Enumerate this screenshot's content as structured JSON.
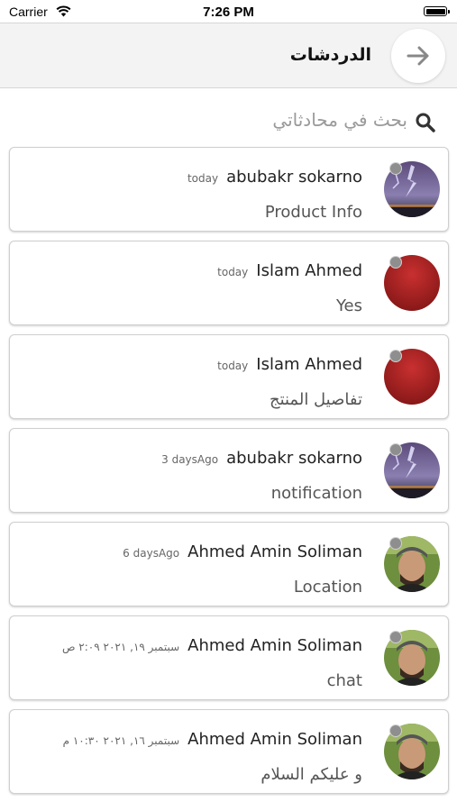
{
  "status_bar": {
    "carrier": "Carrier",
    "time": "7:26 PM"
  },
  "header": {
    "title": "الدردشات"
  },
  "search": {
    "placeholder": "بحث في محادثاتي"
  },
  "chats": [
    {
      "name": "abubakr sokarno",
      "time": "today",
      "message": "Product Info",
      "avatar": "storm-avatar"
    },
    {
      "name": "Islam Ahmed",
      "time": "today",
      "message": "Yes",
      "avatar": "red-avatar"
    },
    {
      "name": "Islam Ahmed",
      "time": "today",
      "message": "تفاصيل المنتج",
      "avatar": "red-avatar"
    },
    {
      "name": "abubakr sokarno",
      "time": "3 daysAgo",
      "message": "notification",
      "avatar": "storm-avatar"
    },
    {
      "name": "Ahmed Amin Soliman",
      "time": "6 daysAgo",
      "message": "Location",
      "avatar": "person-avatar"
    },
    {
      "name": "Ahmed Amin Soliman",
      "time": "سبتمبر ١٩, ٢٠٢١ ٢:٠٩ ص",
      "message": "chat",
      "avatar": "person-avatar"
    },
    {
      "name": "Ahmed Amin Soliman",
      "time": "سبتمبر ١٦, ٢٠٢١ ١٠:٣٠ م",
      "message": "و عليكم السلام",
      "avatar": "person-avatar"
    }
  ]
}
